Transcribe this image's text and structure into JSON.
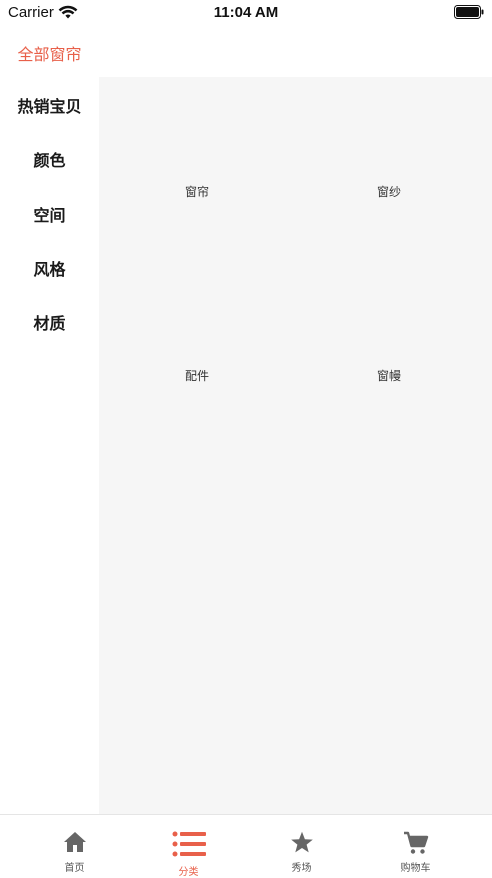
{
  "status_bar": {
    "carrier": "Carrier",
    "time": "11:04 AM"
  },
  "sidebar": {
    "items": [
      {
        "label": "全部窗帘",
        "active": true
      },
      {
        "label": "热销宝贝",
        "active": false
      },
      {
        "label": "颜色",
        "active": false
      },
      {
        "label": "空间",
        "active": false
      },
      {
        "label": "风格",
        "active": false
      },
      {
        "label": "材质",
        "active": false
      }
    ]
  },
  "content": {
    "categories": [
      {
        "label": "窗帘"
      },
      {
        "label": "窗纱"
      },
      {
        "label": "配件"
      },
      {
        "label": "窗幔"
      }
    ]
  },
  "tabbar": {
    "tabs": [
      {
        "label": "首页",
        "icon": "home-icon",
        "active": false
      },
      {
        "label": "分类",
        "icon": "list-icon",
        "active": true
      },
      {
        "label": "秀场",
        "icon": "star-icon",
        "active": false
      },
      {
        "label": "购物车",
        "icon": "cart-icon",
        "active": false
      }
    ]
  },
  "colors": {
    "accent": "#e8604a",
    "content_bg": "#f6f6f6",
    "icon_gray": "#666666"
  }
}
